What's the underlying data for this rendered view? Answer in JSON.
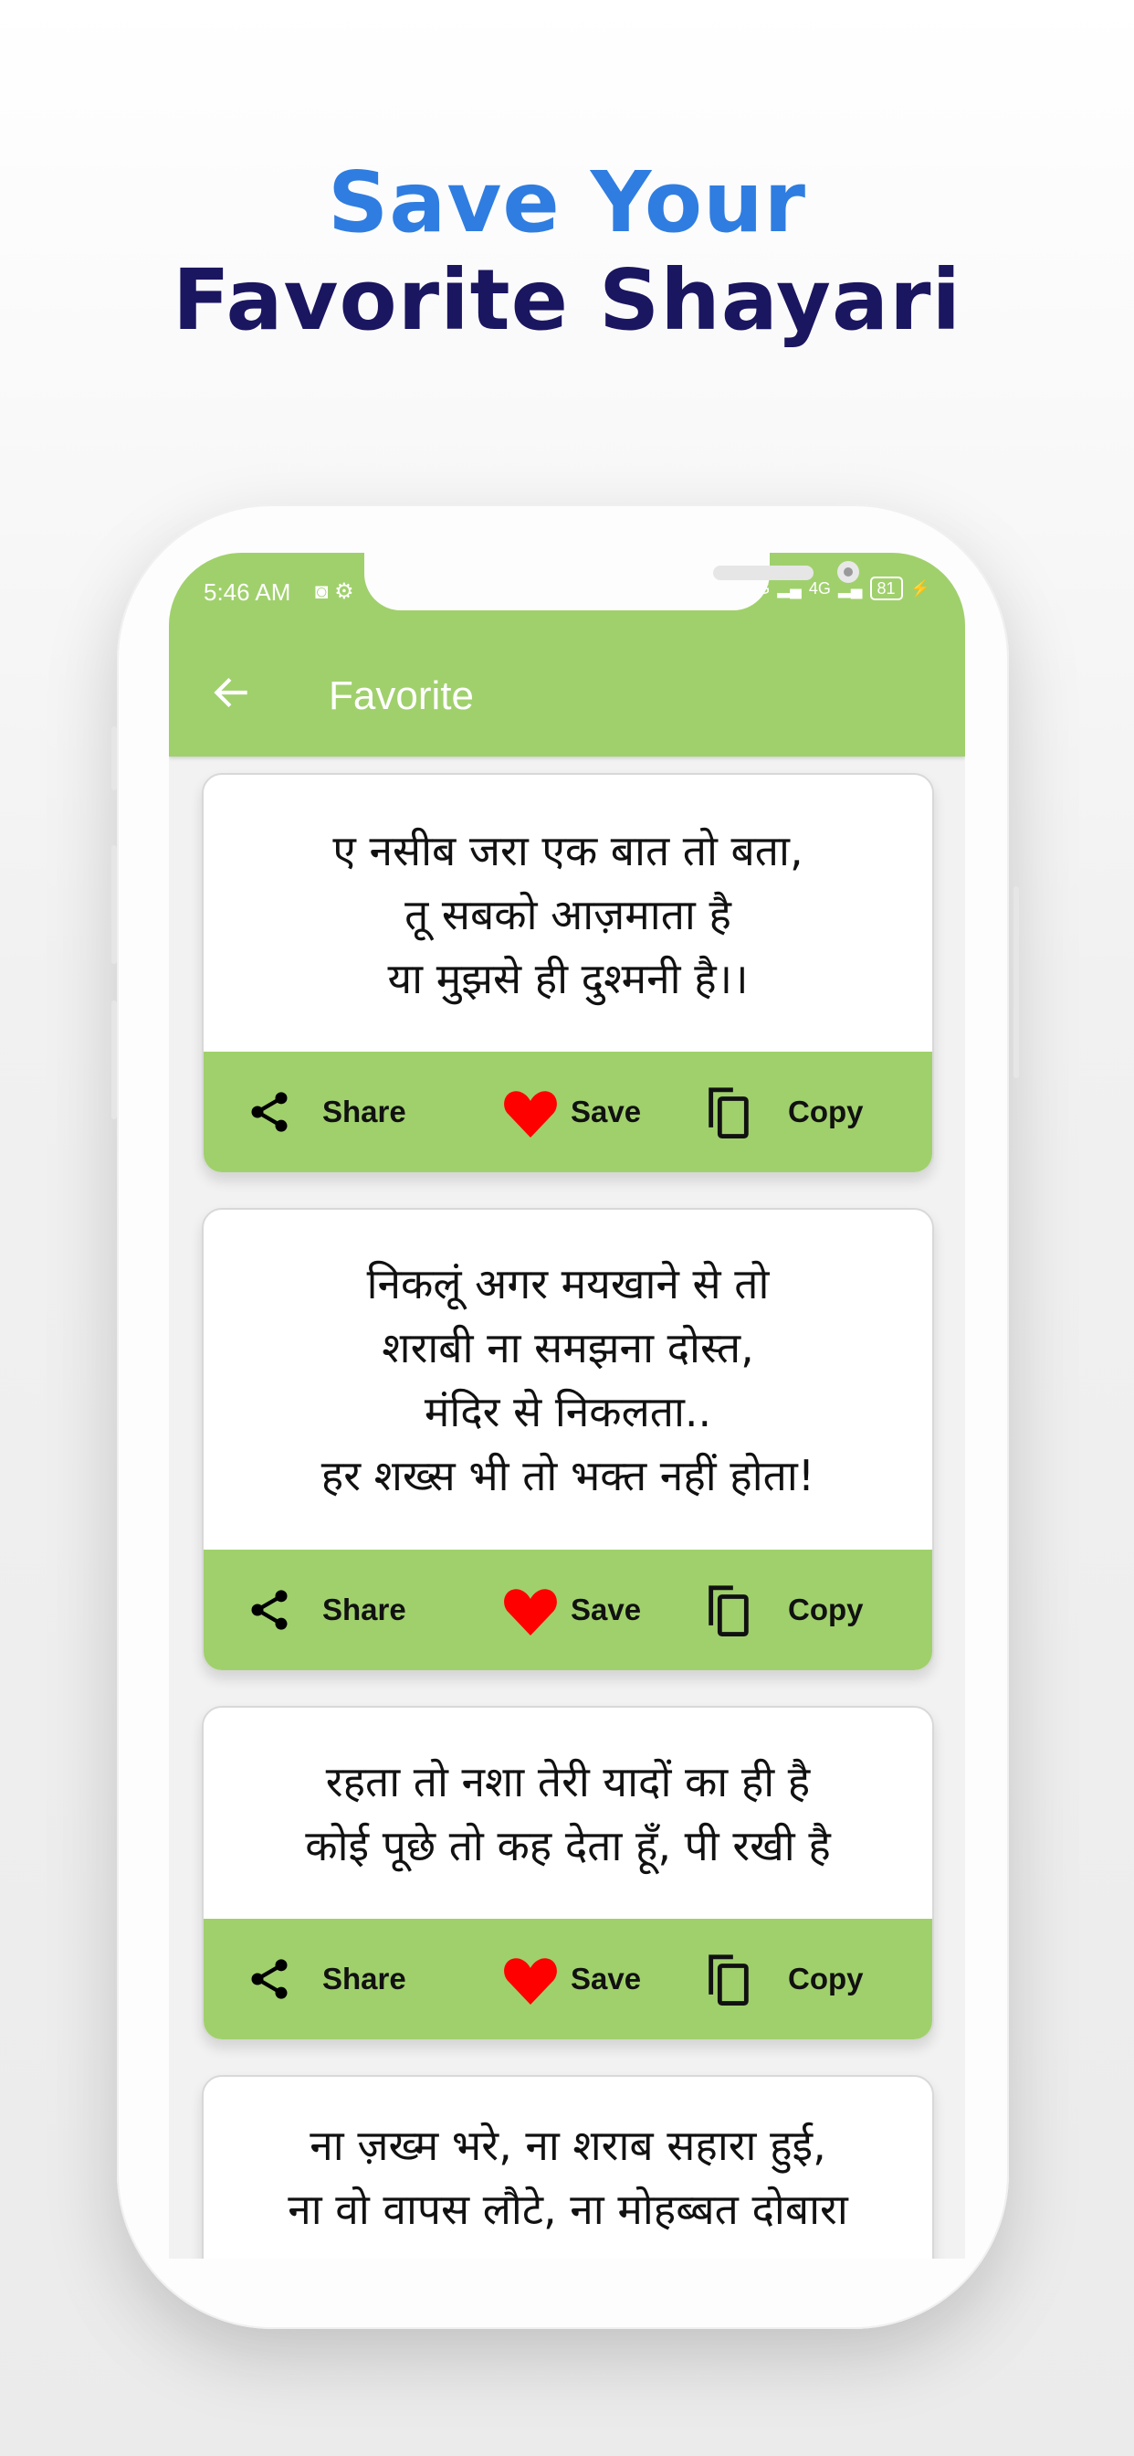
{
  "promo": {
    "line1": "Save Your",
    "line2": "Favorite Shayari"
  },
  "status_bar": {
    "time": "5:46 AM",
    "network1": "4G",
    "network2": "4G",
    "battery": "81"
  },
  "toolbar": {
    "title": "Favorite"
  },
  "actions": {
    "share": "Share",
    "save": "Save",
    "copy": "Copy"
  },
  "colors": {
    "accent": "#a0d06c",
    "heart": "#ff0000",
    "headline_blue": "#2f7de1",
    "headline_navy": "#1b1660"
  },
  "cards": [
    {
      "lines": [
        "ए नसीब जरा एक बात तो बता,",
        "तू सबको आज़माता है",
        "या मुझसे ही दुश्मनी है।।"
      ]
    },
    {
      "lines": [
        "निकलूं अगर मयखाने से तो",
        "शराबी ना समझना दोस्त,",
        "मंदिर से निकलता..",
        "हर शख्स भी तो भक्त नहीं होता!"
      ]
    },
    {
      "lines": [
        "रहता तो नशा तेरी यादों का ही है",
        "कोई पूछे तो कह देता हूँ, पी रखी है"
      ]
    },
    {
      "lines": [
        "ना ज़ख्म भरे, ना शराब सहारा हुई,",
        "ना वो वापस लौटे, ना मोहब्बत दोबारा"
      ]
    }
  ]
}
